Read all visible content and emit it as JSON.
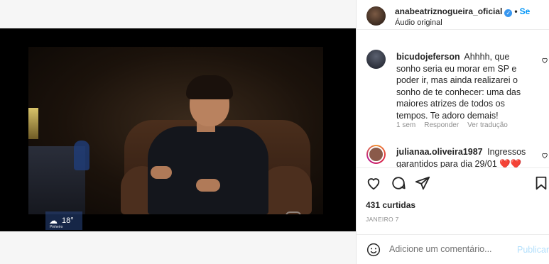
{
  "post": {
    "author": "anabeatriznogueira_oficial",
    "verified_badge": "✓",
    "separator": "•",
    "follow_label": "Se",
    "audio": "Áudio original"
  },
  "video": {
    "weather_temp": "18°",
    "weather_label": "Pinheiro",
    "weather_icon": "cloud-icon",
    "mute_icon": "speaker-muted-icon"
  },
  "comments": [
    {
      "user": "bicudojeferson",
      "text": "Ahhhh, que sonho seria eu morar em SP e poder ir, mas ainda realizarei o sonho de te conhecer: uma das maiores atrizes de todos os tempos. Te adoro demais!",
      "time": "1 sem",
      "reply": "Responder",
      "translate": "Ver tradução"
    },
    {
      "user": "julianaa.oliveira1987",
      "text": "Ingressos garantidos para dia 29/01 ❤️❤️"
    }
  ],
  "actions": {
    "like_icon": "heart-icon",
    "comment_icon": "comment-icon",
    "share_icon": "send-icon",
    "save_icon": "bookmark-icon"
  },
  "likes": "431 curtidas",
  "date": "JANEIRO 7",
  "composer": {
    "placeholder": "Adicione um comentário...",
    "publish_label": "Publicar"
  }
}
